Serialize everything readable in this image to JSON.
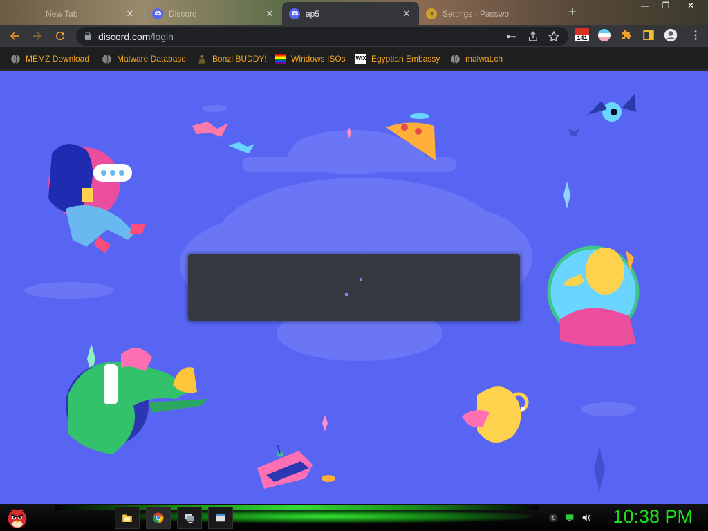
{
  "tabs": [
    {
      "title": "New Tab",
      "favicon": "globe-icon",
      "active": false
    },
    {
      "title": "Discord",
      "favicon": "discord-icon",
      "active": false
    },
    {
      "title": "ap5",
      "favicon": "discord-icon",
      "active": true
    },
    {
      "title": "Settings - Passwo",
      "favicon": "gear-icon",
      "active": false
    }
  ],
  "toolbar": {
    "url_host": "discord.com",
    "url_path": "/login",
    "extension_badge": "141"
  },
  "bookmarks": [
    {
      "label": "MEMZ Download",
      "icon": "globe-icon"
    },
    {
      "label": "Malware Database",
      "icon": "globe-icon"
    },
    {
      "label": "Bonzi BUDDY!",
      "icon": "bonzi-icon"
    },
    {
      "label": "Windows ISOs",
      "icon": "rainbow-flag-icon"
    },
    {
      "label": "Egyptian Embassy",
      "icon": "wix-icon"
    },
    {
      "label": "malwat.ch",
      "icon": "globe-icon"
    }
  ],
  "taskbar": {
    "clock": "10:38 PM",
    "items": [
      "file-explorer-icon",
      "chrome-icon",
      "display-settings-icon",
      "window-icon"
    ]
  },
  "colors": {
    "page_background": "#5865f2",
    "loading_card": "#36393f",
    "clock": "#19e319",
    "bookmark_text": "#f5a623"
  }
}
